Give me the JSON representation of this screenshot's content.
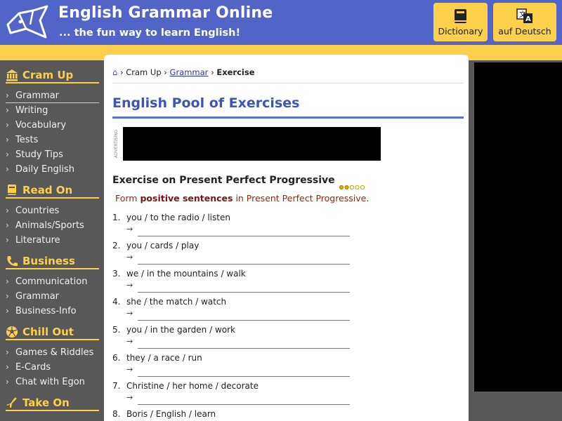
{
  "header": {
    "title": "English Grammar Online",
    "subtitle": "... the fun way to learn English!",
    "buttons": [
      {
        "label": "Dictionary",
        "icon": "book-icon"
      },
      {
        "label": "auf Deutsch",
        "icon": "translate-icon"
      }
    ]
  },
  "sidebar": {
    "sections": [
      {
        "title": "Cram Up",
        "icon": "bank-icon",
        "items": [
          "Grammar",
          "Writing",
          "Vocabulary",
          "Tests",
          "Study Tips",
          "Daily English"
        ]
      },
      {
        "title": "Read On",
        "icon": "book-icon",
        "items": [
          "Countries",
          "Animals/Sports",
          "Literature"
        ]
      },
      {
        "title": "Business",
        "icon": "phone-icon",
        "items": [
          "Communication",
          "Grammar",
          "Business-Info"
        ]
      },
      {
        "title": "Chill Out",
        "icon": "soccer-ball-icon",
        "items": [
          "Games & Riddles",
          "E-Cards",
          "Chat with Egon"
        ]
      },
      {
        "title": "Take On",
        "icon": "plane-icon",
        "items": []
      }
    ]
  },
  "breadcrumb": {
    "home_icon": "home-icon",
    "items": [
      "Cram Up",
      "Grammar",
      "Exercise"
    ]
  },
  "main": {
    "page_title": "English Pool of Exercises",
    "ad_label": "ADVERTISING",
    "exercise_title": "Exercise on Present Perfect Progressive",
    "difficulty": {
      "level": 2,
      "max": 5
    },
    "instruction": {
      "prefix": "Form ",
      "emphasis": "positive sentences",
      "suffix": " in Present Perfect Progressive."
    },
    "questions": [
      {
        "num": "1.",
        "text": "you / to the radio / listen",
        "answer": ""
      },
      {
        "num": "2.",
        "text": "you / cards / play",
        "answer": ""
      },
      {
        "num": "3.",
        "text": "we / in the mountains / walk",
        "answer": ""
      },
      {
        "num": "4.",
        "text": "she / the match / watch",
        "answer": ""
      },
      {
        "num": "5.",
        "text": "you / in the garden / work",
        "answer": ""
      },
      {
        "num": "6.",
        "text": "they / a race / run",
        "answer": ""
      },
      {
        "num": "7.",
        "text": "Christine / her home / decorate",
        "answer": ""
      },
      {
        "num": "8.",
        "text": "Boris / English / learn",
        "answer": ""
      }
    ],
    "arrow_glyph": "→"
  },
  "colors": {
    "header_blue": "#5165c8",
    "accent_yellow": "#fcd04b",
    "sidebar_gray": "#585858",
    "title_blue": "#3e55b8",
    "instruction_red": "#8b2a1d"
  }
}
